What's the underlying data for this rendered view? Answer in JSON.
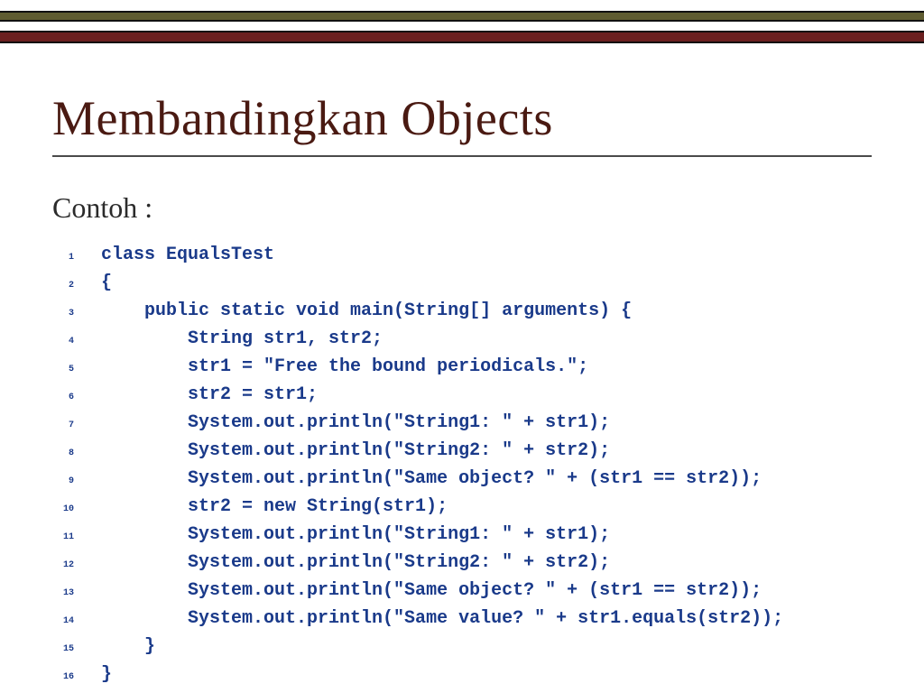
{
  "title": "Membandingkan Objects",
  "subheading": "Contoh :",
  "code": {
    "lines": [
      {
        "n": "1",
        "t": "  class EqualsTest"
      },
      {
        "n": "2",
        "t": "  {"
      },
      {
        "n": "3",
        "t": "      public static void main(String[] arguments) {"
      },
      {
        "n": "4",
        "t": "          String str1, str2;"
      },
      {
        "n": "5",
        "t": "          str1 = \"Free the bound periodicals.\";"
      },
      {
        "n": "6",
        "t": "          str2 = str1;"
      },
      {
        "n": "7",
        "t": "          System.out.println(\"String1: \" + str1);"
      },
      {
        "n": "8",
        "t": "          System.out.println(\"String2: \" + str2);"
      },
      {
        "n": "9",
        "t": "          System.out.println(\"Same object? \" + (str1 == str2));"
      },
      {
        "n": "10",
        "t": "          str2 = new String(str1);"
      },
      {
        "n": "11",
        "t": "          System.out.println(\"String1: \" + str1);"
      },
      {
        "n": "12",
        "t": "          System.out.println(\"String2: \" + str2);"
      },
      {
        "n": "13",
        "t": "          System.out.println(\"Same object? \" + (str1 == str2));"
      },
      {
        "n": "14",
        "t": "          System.out.println(\"Same value? \" + str1.equals(str2));"
      },
      {
        "n": "15",
        "t": "      }"
      },
      {
        "n": "16",
        "t": "  }"
      }
    ]
  }
}
